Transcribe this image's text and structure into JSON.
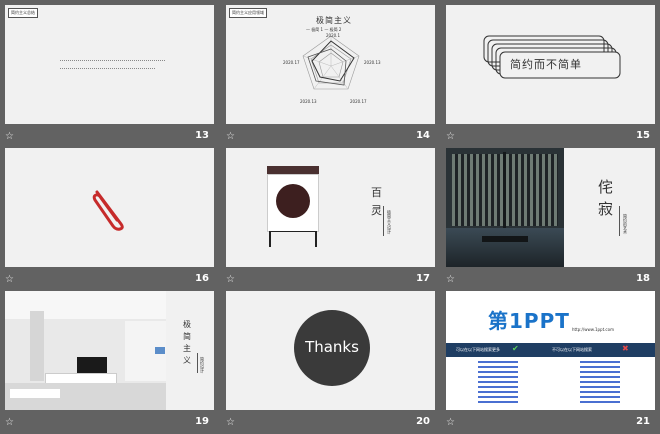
{
  "slides": [
    {
      "num": "13",
      "title": "简约主义总结"
    },
    {
      "num": "14",
      "title": "简约主义应用领域",
      "heading": "极简主义",
      "legend": [
        "— 极简 1 — 极简 2"
      ],
      "axis": [
        "2020.1",
        "2020.13",
        "2020.17",
        "2020.13",
        "2020.17"
      ]
    },
    {
      "num": "15",
      "text": "简约而不简单"
    },
    {
      "num": "16"
    },
    {
      "num": "17",
      "v1": "百",
      "v2": "灵",
      "v3": "极简主义设计"
    },
    {
      "num": "18",
      "v1": "侘",
      "v2": "寂",
      "v3": "简约的艺术"
    },
    {
      "num": "19",
      "v1": "极",
      "v2": "简",
      "v3": "主",
      "v4": "义",
      "v5": "简约设计"
    },
    {
      "num": "20",
      "text": "Thanks"
    },
    {
      "num": "21",
      "logo": "第1PPT",
      "url": "http://www.1ppt.com",
      "left_head": "可以在以下网站搜索更多",
      "right_head": "不可以在以下网站搜索"
    }
  ],
  "star": "☆",
  "colors": {
    "bg": "#626262",
    "slide": "#f1f1f1",
    "red": "#d33",
    "blue": "#1a73c9",
    "dark": "#3a3a3a"
  }
}
